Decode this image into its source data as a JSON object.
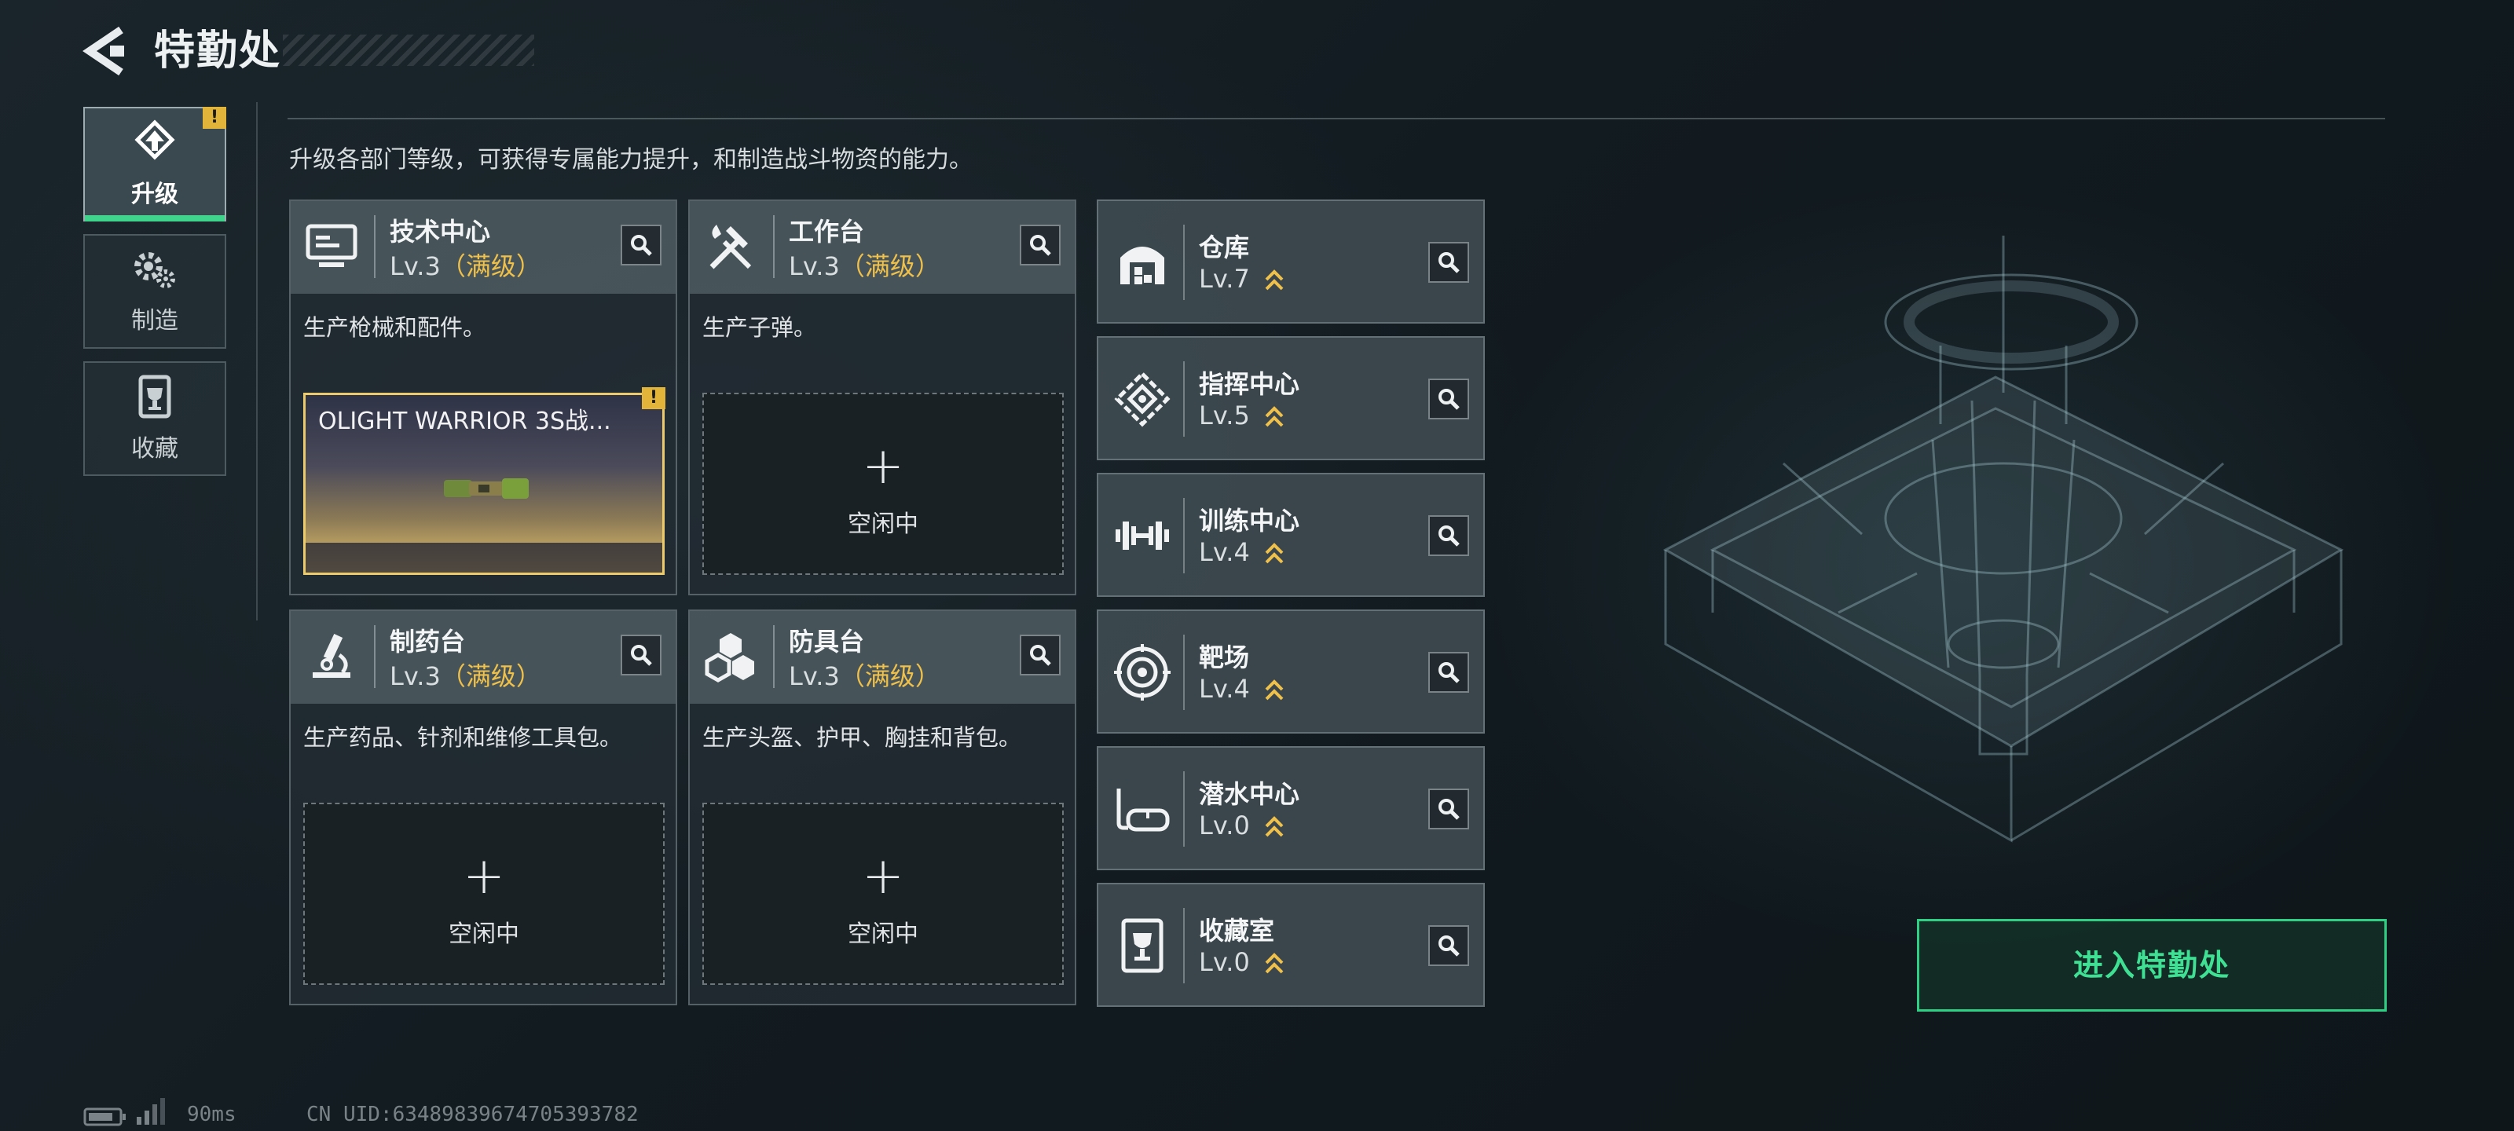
{
  "header": {
    "title": "特勤处"
  },
  "nav": {
    "items": [
      {
        "label": "升级",
        "icon": "upgrade-icon",
        "active": true,
        "alert": "!"
      },
      {
        "label": "制造",
        "icon": "gears-icon",
        "active": false
      },
      {
        "label": "收藏",
        "icon": "trophy-case-icon",
        "active": false
      }
    ]
  },
  "subtitle": "升级各部门等级，可获得专属能力提升，和制造战斗物资的能力。",
  "workshops": [
    {
      "name": "技术中心",
      "level": "Lv.3",
      "maxed": "（满级）",
      "icon": "computer-icon",
      "description": "生产枪械和配件。",
      "slot": {
        "state": "active",
        "item_name": "OLIGHT WARRIOR 3S战...",
        "alert": "!"
      }
    },
    {
      "name": "工作台",
      "level": "Lv.3",
      "maxed": "（满级）",
      "icon": "tools-icon",
      "description": "生产子弹。",
      "slot": {
        "state": "idle",
        "plus": "+",
        "label": "空闲中"
      }
    },
    {
      "name": "制药台",
      "level": "Lv.3",
      "maxed": "（满级）",
      "icon": "microscope-icon",
      "description": "生产药品、针剂和维修工具包。",
      "slot": {
        "state": "idle",
        "plus": "+",
        "label": "空闲中"
      }
    },
    {
      "name": "防具台",
      "level": "Lv.3",
      "maxed": "（满级）",
      "icon": "cubes-icon",
      "description": "生产头盔、护甲、胸挂和背包。",
      "slot": {
        "state": "idle",
        "plus": "+",
        "label": "空闲中"
      }
    }
  ],
  "facilities": [
    {
      "name": "仓库",
      "level": "Lv.7",
      "icon": "warehouse-icon"
    },
    {
      "name": "指挥中心",
      "level": "Lv.5",
      "icon": "command-center-icon"
    },
    {
      "name": "训练中心",
      "level": "Lv.4",
      "icon": "dumbbell-icon"
    },
    {
      "name": "靶场",
      "level": "Lv.4",
      "icon": "target-icon"
    },
    {
      "name": "潜水中心",
      "level": "Lv.0",
      "icon": "diving-mask-icon"
    },
    {
      "name": "收藏室",
      "level": "Lv.0",
      "icon": "collection-room-icon"
    }
  ],
  "enter_button": "进入特勤处",
  "status_bar": {
    "ping": "90ms",
    "uid": "CN UID:6348983967470539378​2"
  },
  "colors": {
    "accent_green": "#2fd083",
    "maxed_gold": "#efc04a",
    "alert_yellow": "#e2b43a"
  }
}
